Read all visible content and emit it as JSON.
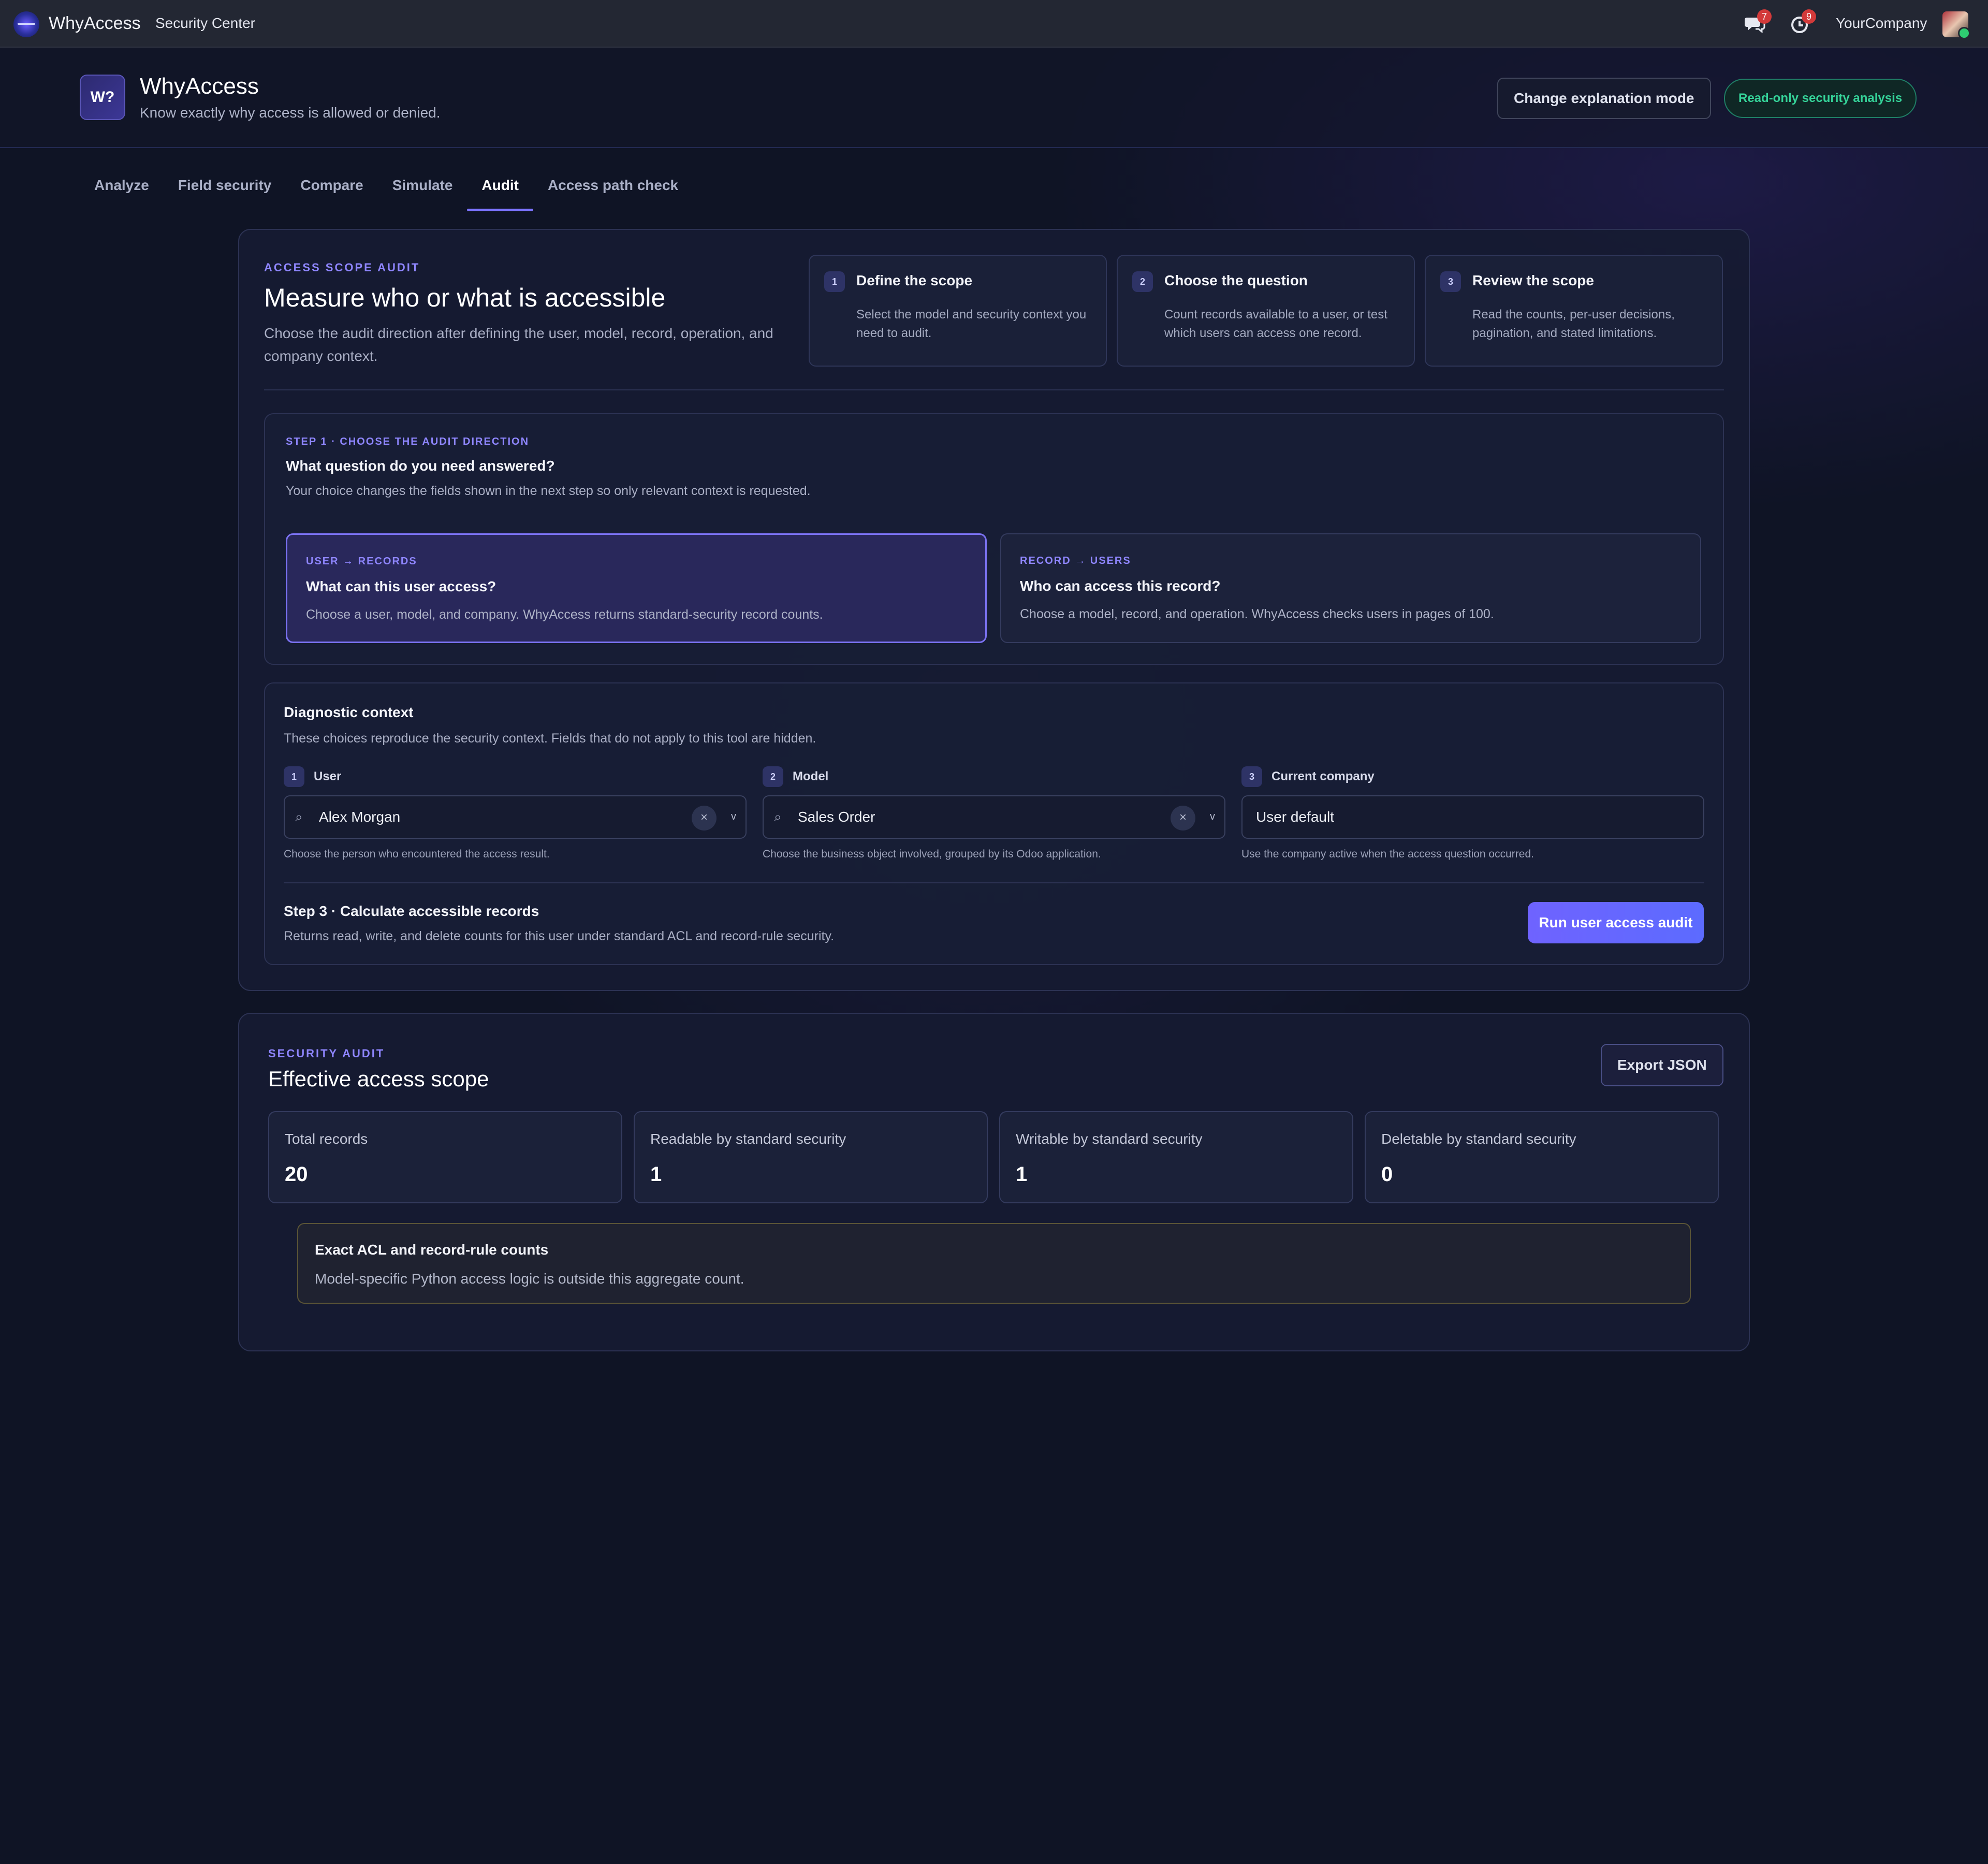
{
  "topbar": {
    "app_name": "WhyAccess",
    "section": "Security Center",
    "messages_count": "7",
    "activity_count": "9",
    "company": "YourCompany"
  },
  "header": {
    "logo_text": "W?",
    "title": "WhyAccess",
    "subtitle": "Know exactly why access is allowed or denied.",
    "change_mode_label": "Change explanation mode",
    "readonly_badge": "Read-only security analysis"
  },
  "tabs": [
    {
      "label": "Analyze"
    },
    {
      "label": "Field security"
    },
    {
      "label": "Compare"
    },
    {
      "label": "Simulate"
    },
    {
      "label": "Audit"
    },
    {
      "label": "Access path check"
    }
  ],
  "scope": {
    "eyebrow": "ACCESS SCOPE AUDIT",
    "title": "Measure who or what is accessible",
    "description": "Choose the audit direction after defining the user, model, record, operation, and company context.",
    "steps": [
      {
        "num": "1",
        "title": "Define the scope",
        "desc": "Select the model and security context you need to audit."
      },
      {
        "num": "2",
        "title": "Choose the question",
        "desc": "Count records available to a user, or test which users can access one record."
      },
      {
        "num": "3",
        "title": "Review the scope",
        "desc": "Read the counts, per-user decisions, pagination, and stated limitations."
      }
    ]
  },
  "direction": {
    "eyebrow": "STEP 1 · CHOOSE THE AUDIT DIRECTION",
    "title": "What question do you need answered?",
    "description": "Your choice changes the fields shown in the next step so only relevant context is requested.",
    "options": [
      {
        "eyebrow": "USER → RECORDS",
        "title": "What can this user access?",
        "desc": "Choose a user, model, and company. WhyAccess returns standard-security record counts."
      },
      {
        "eyebrow": "RECORD → USERS",
        "title": "Who can access this record?",
        "desc": "Choose a model, record, and operation. WhyAccess checks users in pages of 100."
      }
    ]
  },
  "context": {
    "title": "Diagnostic context",
    "description": "These choices reproduce the security context. Fields that do not apply to this tool are hidden.",
    "fields": [
      {
        "num": "1",
        "label": "User",
        "value": "Alex Morgan",
        "help": "Choose the person who encountered the access result."
      },
      {
        "num": "2",
        "label": "Model",
        "value": "Sales Order",
        "help": "Choose the business object involved, grouped by its Odoo application."
      },
      {
        "num": "3",
        "label": "Current company",
        "value": "User default",
        "help": "Use the company active when the access question occurred."
      }
    ],
    "step3_title": "Step 3 · Calculate accessible records",
    "step3_desc": "Returns read, write, and delete counts for this user under standard ACL and record-rule security.",
    "run_label": "Run user access audit"
  },
  "audit": {
    "eyebrow": "SECURITY AUDIT",
    "title": "Effective access scope",
    "export_label": "Export JSON",
    "metrics": [
      {
        "label": "Total records",
        "value": "20"
      },
      {
        "label": "Readable by standard security",
        "value": "1"
      },
      {
        "label": "Writable by standard security",
        "value": "1"
      },
      {
        "label": "Deletable by standard security",
        "value": "0"
      }
    ],
    "note_title": "Exact ACL and record-rule counts",
    "note_desc": "Model-specific Python access logic is outside this aggregate count."
  }
}
